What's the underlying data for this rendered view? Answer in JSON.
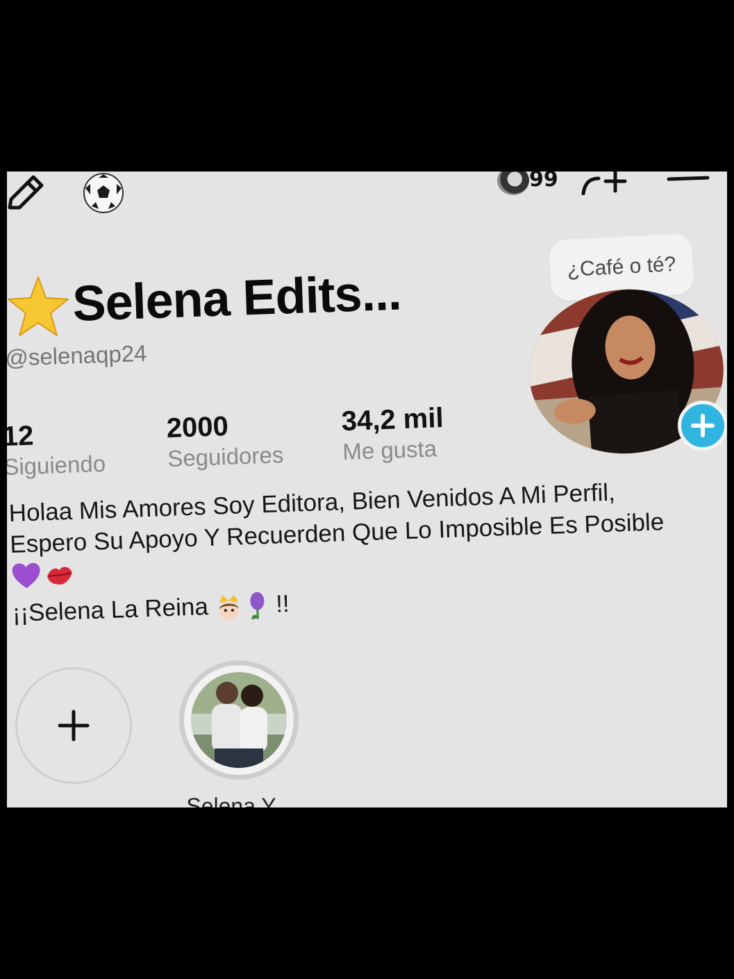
{
  "topbar": {
    "left_icons": [
      "pencil-icon",
      "soccer-ball-icon"
    ],
    "notification_count": "99",
    "right_icons": [
      "add-friend-icon",
      "menu-icon"
    ]
  },
  "note_bubble": {
    "text": "¿Café o té?"
  },
  "profile": {
    "name_emoji": "star-icon",
    "display_name": "Selena Edits...",
    "username": "@selenaqp24"
  },
  "stats": {
    "following": {
      "value": "12",
      "label": "Siguiendo"
    },
    "followers": {
      "value": "2000",
      "label": "Seguidores"
    },
    "likes": {
      "value": "34,2 mil",
      "label": "Me gusta"
    }
  },
  "bio": {
    "line1": "Holaa Mis Amores Soy Editora, Bien Venidos A Mi Perfil,",
    "line2": "Espero Su Apoyo Y Recuerden Que Lo Imposible Es Posible",
    "line3_emojis": [
      "purple-heart-icon",
      "kiss-mark-icon"
    ],
    "line4_text": "¡¡Selena La Reina",
    "line4_emojis": [
      "princess-icon",
      "hyacinth-icon"
    ],
    "line4_end": "!!"
  },
  "highlights": {
    "new_icon": "plus-icon",
    "items": [
      {
        "label": "Selena Y"
      }
    ]
  },
  "colors": {
    "background": "#e4e4e4",
    "accent_blue": "#2fb5e0",
    "text_primary": "#111111",
    "text_secondary": "#8a8a8a"
  }
}
